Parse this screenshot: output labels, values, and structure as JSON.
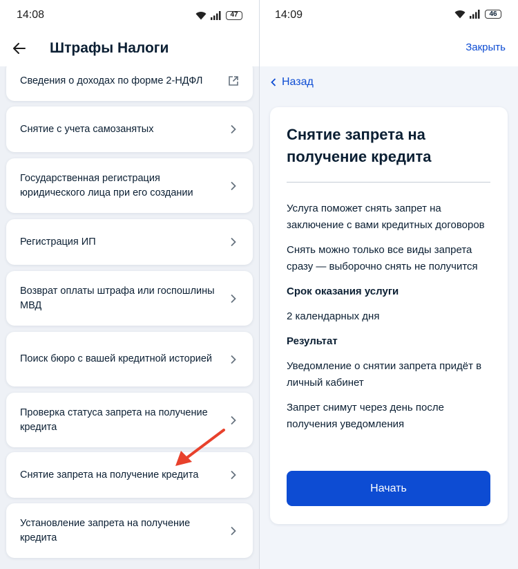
{
  "left": {
    "status": {
      "time": "14:08",
      "battery": "47"
    },
    "appbar": {
      "title": "Штрафы Налоги"
    },
    "items": [
      {
        "label": "Сведения о доходах по форме 2-НДФЛ",
        "icon": "external-link-icon"
      },
      {
        "label": "Снятие с учета самозанятых",
        "icon": "chevron-right-icon"
      },
      {
        "label": "Государственная регистрация юридического лица при его создании",
        "icon": "chevron-right-icon"
      },
      {
        "label": "Регистрация ИП",
        "icon": "chevron-right-icon"
      },
      {
        "label": "Возврат оплаты штрафа или госпошлины МВД",
        "icon": "chevron-right-icon"
      },
      {
        "label": "Поиск бюро с вашей кредитной историей",
        "icon": "chevron-right-icon"
      },
      {
        "label": "Проверка статуса запрета  на получение кредита",
        "icon": "chevron-right-icon"
      },
      {
        "label": "Снятие запрета  на получение кредита",
        "icon": "chevron-right-icon"
      },
      {
        "label": "Установление запрета на получение кредита",
        "icon": "chevron-right-icon"
      }
    ]
  },
  "right": {
    "status": {
      "time": "14:09",
      "battery": "46"
    },
    "close_label": "Закрыть",
    "back_label": "Назад",
    "service": {
      "title": "Снятие запрета на получение кредита",
      "description_1": "Услуга поможет снять запрет на заключение с вами кредитных договоров",
      "description_2": "Снять можно только все виды запрета сразу — выборочно снять не получится",
      "term_heading": "Срок оказания услуги",
      "term_value": "2 календарных дня",
      "result_heading": "Результат",
      "result_1": "Уведомление о снятии запрета придёт в личный кабинет",
      "result_2": "Запрет снимут через день после получения уведомления",
      "start_label": "Начать"
    }
  },
  "colors": {
    "accent": "#0d4cd3",
    "annotation_arrow": "#e8412c",
    "text": "#0b1f33",
    "background": "#eef1f6"
  }
}
